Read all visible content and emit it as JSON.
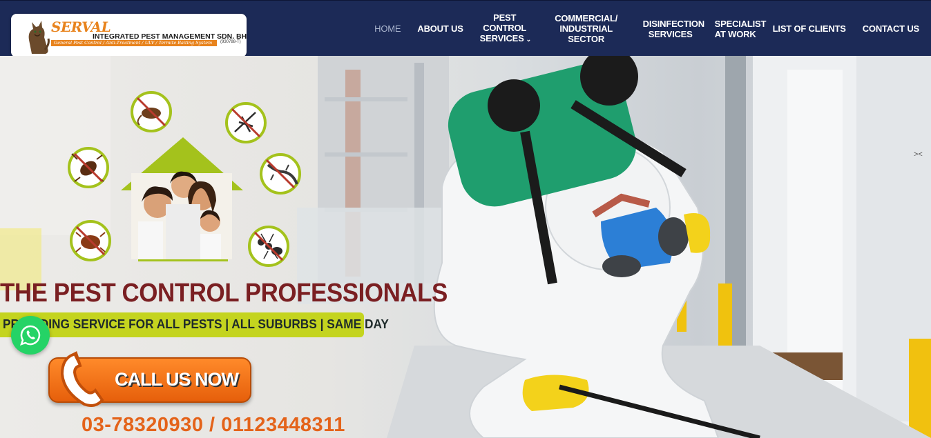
{
  "logo": {
    "brand": "SERVAL",
    "company": "INTEGRATED PEST MANAGEMENT SDN. BHD.",
    "tagline": "General Pest Control / Anti-Treatment / ULV / Termite Baiting System",
    "reg_no": "(930788-T)"
  },
  "nav": {
    "items": [
      {
        "label": "HOME",
        "active": true
      },
      {
        "label": "ABOUT US"
      },
      {
        "label": "PEST CONTROL SERVICES",
        "has_dropdown": true
      },
      {
        "label": "COMMERCIAL/ INDUSTRIAL SECTOR"
      },
      {
        "label": "DISINFECTION SERVICES"
      },
      {
        "label": "SPECIALIST AT WORK"
      },
      {
        "label": "LIST OF CLIENTS"
      },
      {
        "label": "CONTACT US"
      }
    ]
  },
  "hero": {
    "headline": "THE PEST CONTROL PROFESSIONALS",
    "subline": "PROVIDING SERVICE FOR ALL PESTS | ALL SUBURBS | SAME DAY",
    "cta_label": "CALL US NOW",
    "phones": "03-78320930 / 01123448311"
  },
  "colors": {
    "header_bg": "#1c2a57",
    "headline": "#7a1f22",
    "subbar": "#c4d41f",
    "cta": "#f07317",
    "phones": "#e4631a",
    "whatsapp": "#25d366"
  },
  "icons": [
    "cat-logo-icon",
    "rat-prohibited-icon",
    "mosquito-prohibited-icon",
    "cockroach-prohibited-icon",
    "lizard-prohibited-icon",
    "bedbug-prohibited-icon",
    "ant-prohibited-icon",
    "phone-icon",
    "whatsapp-icon"
  ]
}
